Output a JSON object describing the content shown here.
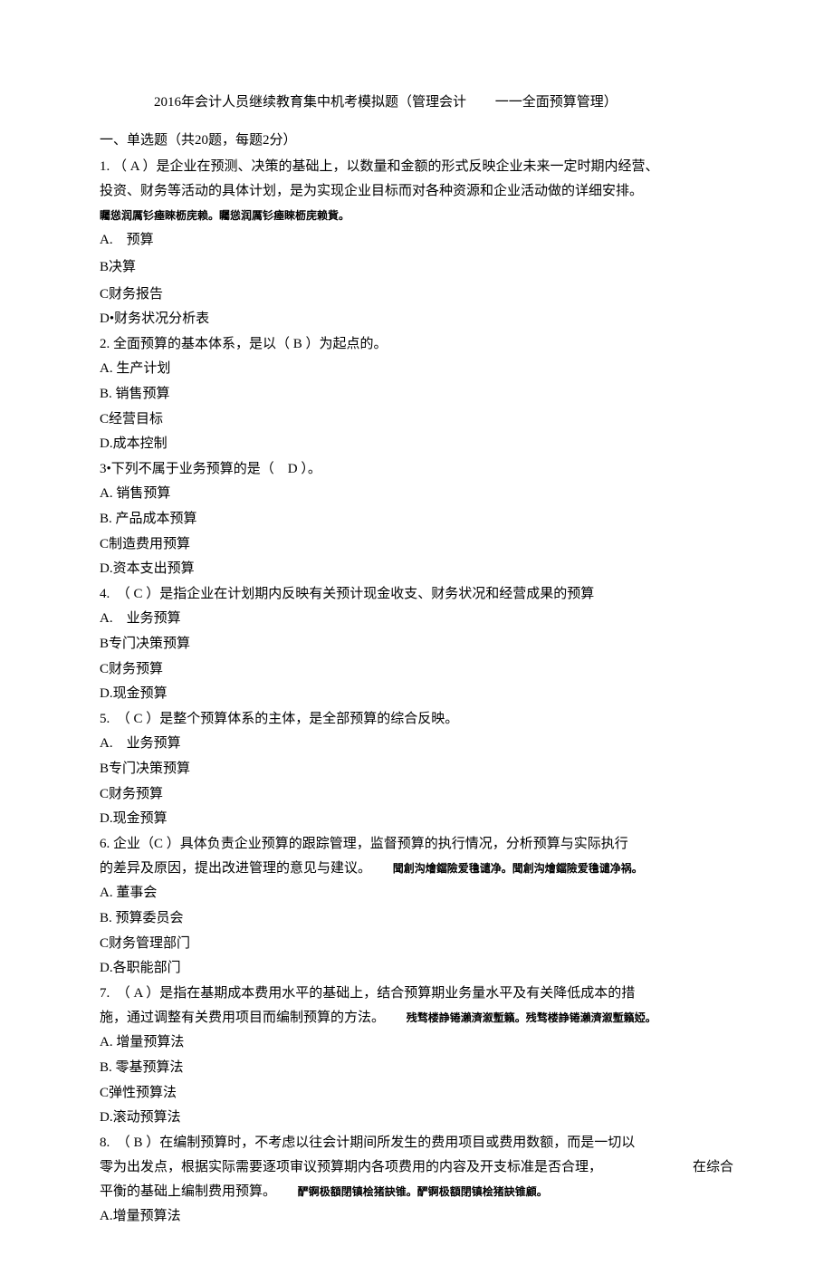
{
  "title": {
    "main": "2016年会计人员继续教育集中机考模拟题（管理会计",
    "sub": "一一全面预算管理）"
  },
  "section_header": "一、单选题（共20题，每题2分）",
  "q1": {
    "line1": "1. （ A ）是企业在预测、决策的基础上，以数量和金额的形式反映企业未来一定时期内经营、",
    "line2": "投资、财务等活动的具体计划，是为实现企业目标而对各种资源和企业活动做的详细安排。",
    "tag": "矚慫润厲钐瘗睞枥庑赖。矚慫润厲钐瘗睞枥庑赖貲。",
    "optA": "A.　预算",
    "optB": "B决算",
    "optC": "C财务报告",
    "optD": "D•财务状况分析表"
  },
  "q2": {
    "text": "2.  全面预算的基本体系，是以（ B ）为起点的。",
    "optA": "A.  生产计划",
    "optB": "B.  销售预算",
    "optC": "C经营目标",
    "optD": "D.成本控制"
  },
  "q3": {
    "text": "3•下列不属于业务预算的是（　D ）。",
    "optA": "A.  销售预算",
    "optB": "B.  产品成本预算",
    "optC": "C制造费用预算",
    "optD": "D.资本支出预算"
  },
  "q4": {
    "text": "4.　（ C ）是指企业在计划期内反映有关预计现金收支、财务状况和经营成果的预算",
    "optA": "A.　业务预算",
    "optB": "B专门决策预算",
    "optC": "C财务预算",
    "optD": "D.现金预算"
  },
  "q5": {
    "text": "5.　（ C ）是整个预算体系的主体，是全部预算的综合反映。",
    "optA": "A.　业务预算",
    "optB": "B专门决策预算",
    "optC": "C财务预算",
    "optD": "D.现金预算"
  },
  "q6": {
    "line1": "6.  企业（C ）具体负责企业预算的跟踪管理，监督预算的执行情况，分析预算与实际执行",
    "line2a": "的差异及原因，提出改进管理的意见与建议。",
    "tag": "聞創沟燴鐺險爱氇谴净。聞創沟燴鐺險爱氇谴净祸。",
    "optA": "A.  董事会",
    "optB": "B.  预算委员会",
    "optC": "C财务管理部门",
    "optD": "D.各职能部门"
  },
  "q7": {
    "line1": "7.　（ A ）是指在基期成本费用水平的基础上，结合预算期业务量水平及有关降低成本的措",
    "line2a": "施，通过调整有关费用项目而编制预算的方法。",
    "tag": "残骛楼諍锩瀨濟溆塹籟。残骛楼諍锩瀨濟溆塹籟婭。",
    "optA": "A.  增量预算法",
    "optB": "B.  零基预算法",
    "optC": "C弹性预算法",
    "optD": "D.滚动预算法"
  },
  "q8": {
    "line1": "8.　（ B ）在编制预算时，不考虑以往会计期间所发生的费用项目或费用数额，而是一切以",
    "line2a": "零为出发点，根据实际需要逐项审议预算期内各项费用的内容及开支标准是否合理，",
    "line2b": "在综合",
    "line3a": "平衡的基础上编制费用预算。",
    "tag": "酽锕极額閉镇桧猪訣锥。酽锕极額閉镇桧猪訣锥顧。",
    "optA": "A.增量预算法"
  }
}
